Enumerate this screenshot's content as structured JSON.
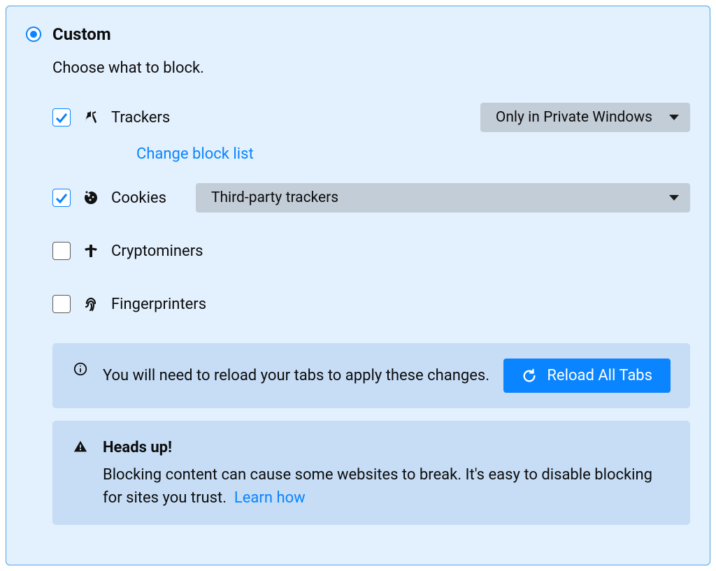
{
  "title": "Custom",
  "subtitle": "Choose what to block.",
  "options": {
    "trackers": {
      "label": "Trackers",
      "checked": true,
      "dropdown": "Only in Private Windows",
      "change_link": "Change block list"
    },
    "cookies": {
      "label": "Cookies",
      "checked": true,
      "dropdown": "Third-party trackers"
    },
    "cryptominers": {
      "label": "Cryptominers",
      "checked": false
    },
    "fingerprinters": {
      "label": "Fingerprinters",
      "checked": false
    }
  },
  "reload_notice": {
    "text": "You will need to reload your tabs to apply these changes.",
    "button": "Reload All Tabs"
  },
  "warning_notice": {
    "heading": "Heads up!",
    "text": "Blocking content can cause some websites to break. It's easy to disable blocking for sites you trust.",
    "link": "Learn how"
  }
}
